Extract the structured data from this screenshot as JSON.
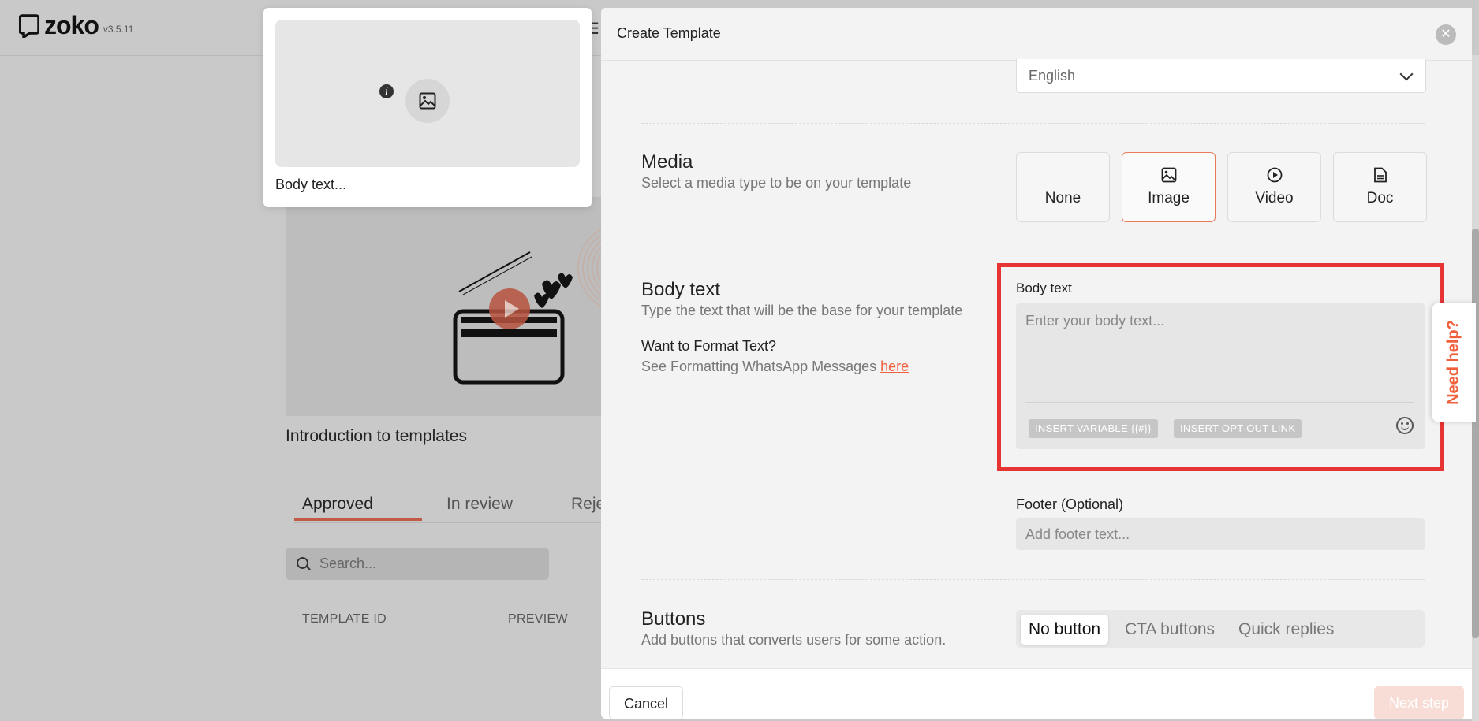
{
  "app": {
    "name": "zoko",
    "version": "v3.5.11"
  },
  "background": {
    "video_title": "Introduction to templates",
    "tabs": [
      {
        "label": "Approved"
      },
      {
        "label": "In review"
      },
      {
        "label": "Reje"
      }
    ],
    "search_placeholder": "Search...",
    "columns": [
      "TEMPLATE ID",
      "PREVIEW"
    ]
  },
  "preview": {
    "body_text": "Body text..."
  },
  "modal": {
    "title": "Create Template",
    "language": {
      "value": "English"
    },
    "media": {
      "title": "Media",
      "subtitle": "Select a media type to be on your template",
      "options": [
        {
          "label": "None",
          "icon": "none",
          "selected": false
        },
        {
          "label": "Image",
          "icon": "image-icon",
          "selected": true
        },
        {
          "label": "Video",
          "icon": "play-circle-icon",
          "selected": false
        },
        {
          "label": "Doc",
          "icon": "document-icon",
          "selected": false
        }
      ]
    },
    "body": {
      "title": "Body text",
      "subtitle": "Type the text that will be the base for your template",
      "format_title": "Want to Format Text?",
      "format_text": "See Formatting WhatsApp Messages",
      "format_link": "here",
      "field_label": "Body text",
      "placeholder": "Enter your body text...",
      "insert_variable": "INSERT VARIABLE {{#}}",
      "insert_opt_out": "INSERT OPT OUT LINK"
    },
    "footer": {
      "label": "Footer (Optional)",
      "placeholder": "Add footer text..."
    },
    "buttons": {
      "title": "Buttons",
      "subtitle": "Add buttons that converts users for some action.",
      "options": [
        "No button",
        "CTA buttons",
        "Quick replies"
      ],
      "selected": "No button"
    },
    "actions": {
      "cancel": "Cancel",
      "next": "Next step"
    }
  },
  "help": {
    "label": "Need help?"
  },
  "colors": {
    "accent": "#f0603c",
    "highlight": "#e63434",
    "selected_border": "#e97a5d"
  }
}
